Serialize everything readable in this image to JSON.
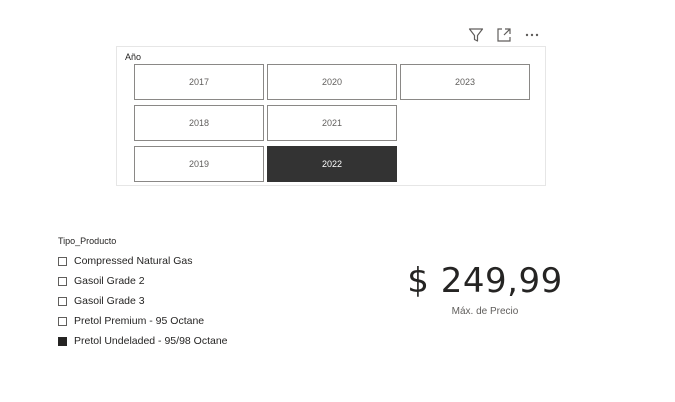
{
  "visual_header": {
    "icons": [
      "filter-icon",
      "focus-mode-icon",
      "more-options-icon"
    ]
  },
  "year_slicer": {
    "title": "Año",
    "tiles": [
      {
        "label": "2017",
        "selected": false
      },
      {
        "label": "2020",
        "selected": false
      },
      {
        "label": "2023",
        "selected": false
      },
      {
        "label": "2018",
        "selected": false
      },
      {
        "label": "2021",
        "selected": false
      },
      {
        "label": "2019",
        "selected": false
      },
      {
        "label": "2022",
        "selected": true
      }
    ]
  },
  "product_slicer": {
    "title": "Tipo_Producto",
    "items": [
      {
        "label": "Compressed Natural Gas",
        "checked": false
      },
      {
        "label": "Gasoil Grade 2",
        "checked": false
      },
      {
        "label": "Gasoil Grade 3",
        "checked": false
      },
      {
        "label": "Pretol Premium - 95 Octane",
        "checked": false
      },
      {
        "label": "Pretol Undeladed - 95/98 Octane",
        "checked": true
      }
    ]
  },
  "card": {
    "value": "$ 249,99",
    "label": "Máx. de Precio"
  },
  "colors": {
    "selected": "#333333",
    "border": "#8a8886",
    "text": "#252423"
  }
}
